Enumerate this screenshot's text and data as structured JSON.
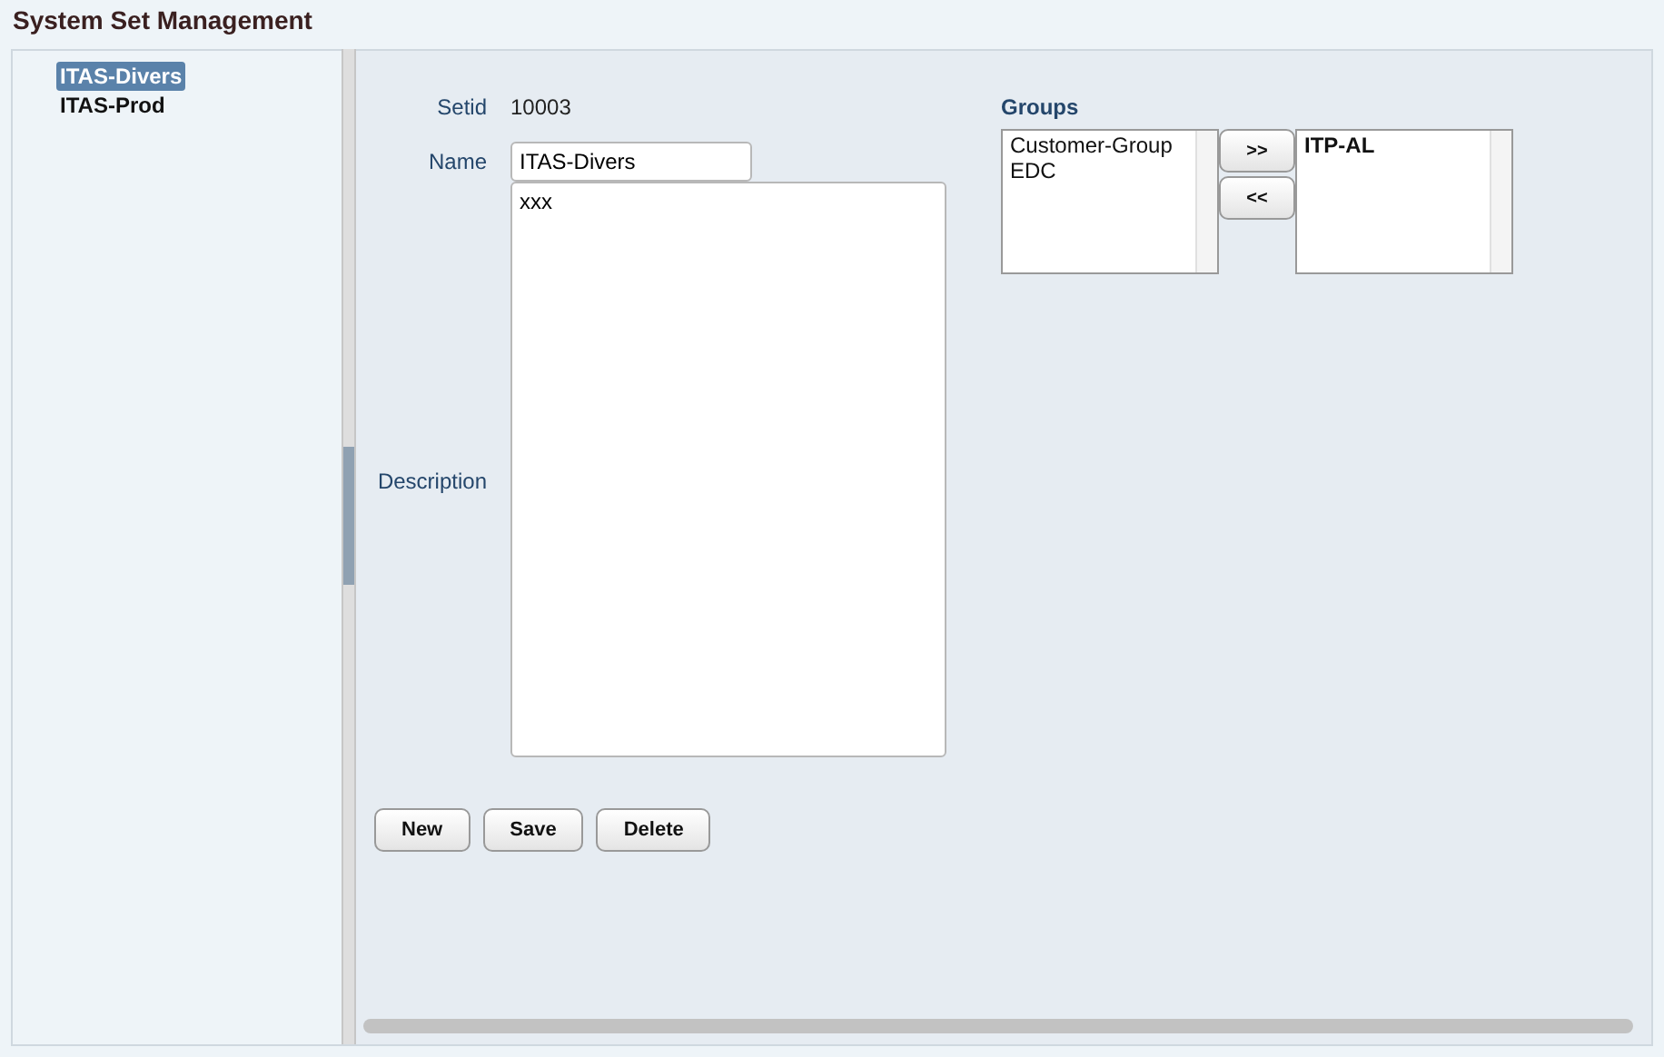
{
  "title": "System Set Management",
  "tree": [
    {
      "label": "ITAS-Divers",
      "selected": true
    },
    {
      "label": "ITAS-Prod",
      "selected": false
    }
  ],
  "form": {
    "setid_label": "Setid",
    "setid_value": "10003",
    "name_label": "Name",
    "name_value": "ITAS-Divers",
    "description_label": "Description",
    "description_value": "xxx"
  },
  "buttons": [
    "New",
    "Save",
    "Delete"
  ],
  "groups": {
    "label": "Groups",
    "available": [
      "Customer-Group",
      "EDC"
    ],
    "add_button": ">>",
    "remove_button": "<<",
    "assigned": [
      "ITP-AL"
    ]
  }
}
